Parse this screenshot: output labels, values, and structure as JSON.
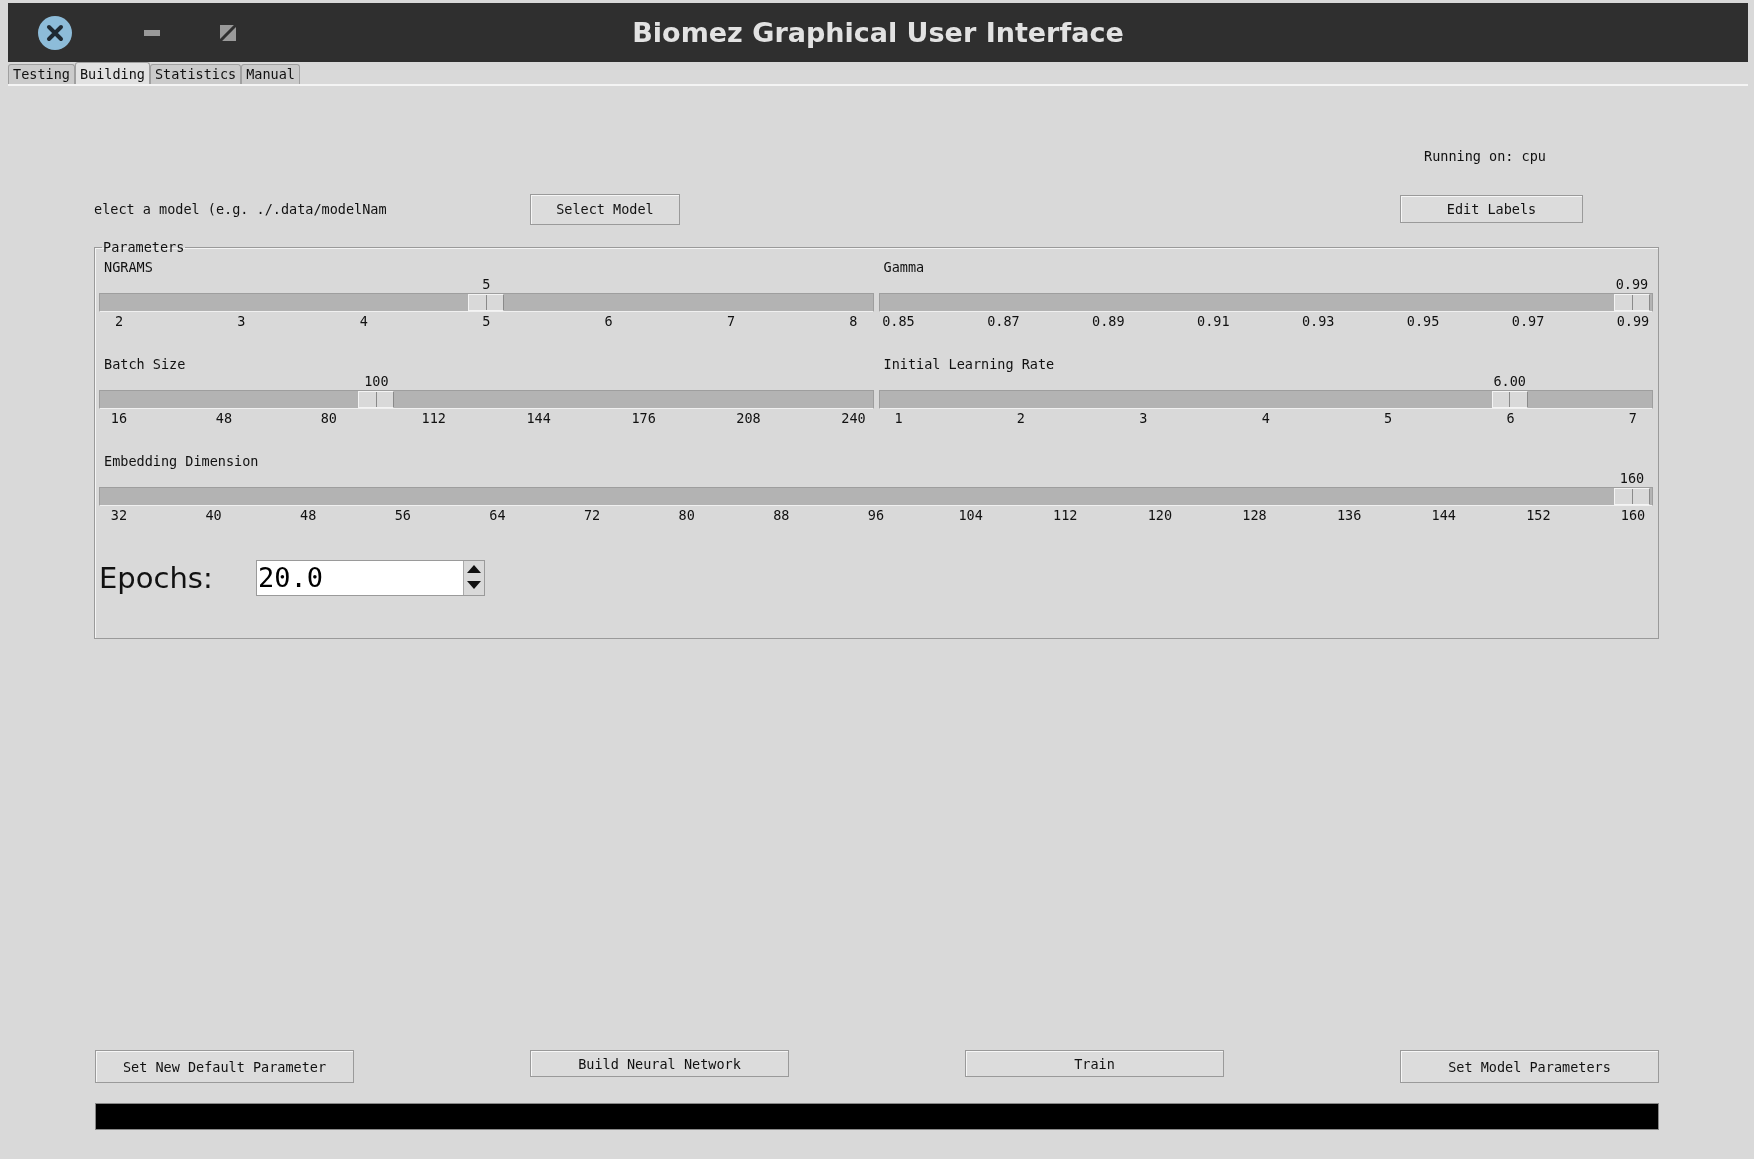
{
  "window": {
    "title": "Biomez Graphical User Interface"
  },
  "tabs": [
    {
      "label": "Testing",
      "selected": false
    },
    {
      "label": "Building",
      "selected": true
    },
    {
      "label": "Statistics",
      "selected": false
    },
    {
      "label": "Manual",
      "selected": false
    }
  ],
  "device_status": "Running on: cpu",
  "model_prompt": "elect a model (e.g. ./.data/modelNam",
  "select_model_button": "Select Model",
  "edit_labels_button": "Edit Labels",
  "parameters": {
    "title": "Parameters",
    "rows": [
      [
        {
          "label": "NGRAMS",
          "value": "5",
          "level": 0.5,
          "ticks": [
            "2",
            "3",
            "4",
            "5",
            "6",
            "7",
            "8"
          ]
        },
        {
          "label": "Gamma",
          "value": "0.99",
          "level": 1,
          "ticks": [
            "0.85",
            "0.87",
            "0.89",
            "0.91",
            "0.93",
            "0.95",
            "0.97",
            "0.99"
          ]
        }
      ],
      [
        {
          "label": "Batch Size",
          "value": "100",
          "level": 0.35,
          "ticks": [
            "16",
            "48",
            "80",
            "112",
            "144",
            "176",
            "208",
            "240"
          ]
        },
        {
          "label": "Initial Learning Rate",
          "value": "6.00",
          "level": 0.833,
          "ticks": [
            "1",
            "2",
            "3",
            "4",
            "5",
            "6",
            "7"
          ]
        }
      ],
      [
        {
          "label": "Embedding Dimension",
          "value": "160",
          "level": 1,
          "ticks": [
            "32",
            "40",
            "48",
            "56",
            "64",
            "72",
            "80",
            "88",
            "96",
            "104",
            "112",
            "120",
            "128",
            "136",
            "144",
            "152",
            "160"
          ]
        }
      ]
    ],
    "epochs": {
      "label": "Epochs:",
      "value": "20.0"
    }
  },
  "buttons": [
    {
      "label": "Set New Default Parameter",
      "kind": "tall"
    },
    {
      "label": "Build Neural Network",
      "kind": "short"
    },
    {
      "label": "Train",
      "kind": "short"
    },
    {
      "label": "Set Model Parameters",
      "kind": "tall"
    }
  ],
  "progress": {
    "level": 0
  }
}
